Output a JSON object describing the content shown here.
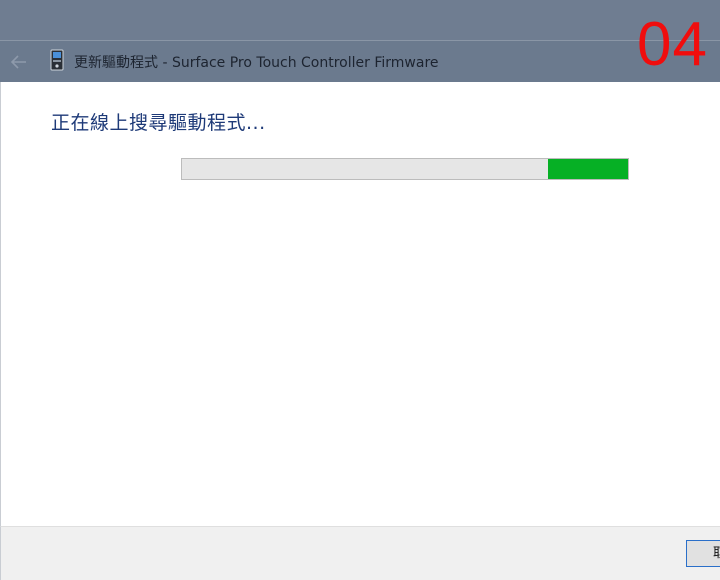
{
  "window": {
    "title": "更新驅動程式 - Surface Pro Touch Controller Firmware"
  },
  "overlay": {
    "step_number": "04"
  },
  "content": {
    "status_heading": "正在線上搜尋驅動程式...",
    "progress": {
      "type": "marquee",
      "segment_start_fraction": 0.82,
      "segment_end_fraction": 1.0,
      "fill_color": "#06b025",
      "track_color": "#e6e6e6"
    }
  },
  "footer": {
    "cancel_label": "取消"
  },
  "icons": {
    "back": "back-arrow-icon",
    "app": "device-icon"
  },
  "colors": {
    "titlebar": "#6b7a8e",
    "heading_text": "#1e3a78",
    "step_badge": "#f00d0d"
  }
}
